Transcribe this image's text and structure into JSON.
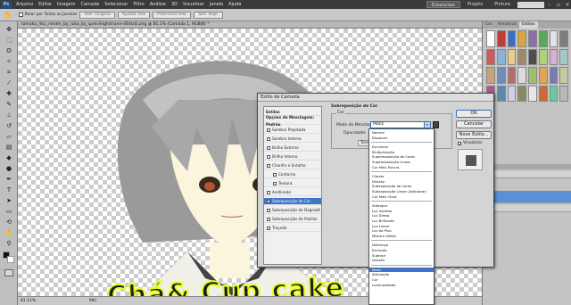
{
  "menubar": {
    "app_badge": "Ps",
    "items": [
      "Arquivo",
      "Editar",
      "Imagem",
      "Camada",
      "Selecionar",
      "Filtro",
      "Análise",
      "3D",
      "Visualizar",
      "Janela",
      "Ajuda"
    ],
    "workspaces": [
      "Essenciais",
      "Projeto",
      "Pintura"
    ],
    "window_controls": [
      "–",
      "▫",
      "×"
    ]
  },
  "options_bar": {
    "checkbox_label": "Rolar por Todas as Janelas",
    "buttons": [
      "Tam. Original",
      "Ajustar Tela",
      "Preencher tela",
      "Tam. Impr."
    ]
  },
  "document": {
    "tab_title": "tamaka_riku_render_by_ruka_by_spmcleightmane-d4hkdz.png @ 81,1% (Camada 1, RGB/8) *"
  },
  "status": {
    "zoom": "81,11%",
    "doc": "Méi"
  },
  "panels": {
    "tabs": [
      "Cor",
      "Amostras",
      "Estilos"
    ],
    "active_tab": "Estilos"
  },
  "dialog": {
    "title": "Estilo de Camada",
    "section_title": "Sobreposição de Cor",
    "group_label": "Cor",
    "blend_mode_label": "Modo de Mesclagem:",
    "blend_mode_value": "Matiz",
    "opacity_label": "Opacidade:",
    "truncated_label": "Tornar",
    "preview_label": "Visualizar",
    "buttons": {
      "ok": "OK",
      "cancel": "Cancelar",
      "new_style": "Novo Estilo..."
    },
    "styles": [
      {
        "label": "Estilos",
        "head": true,
        "checked": false
      },
      {
        "label": "Opções de Mesclagem: Padrão",
        "head": true,
        "checked": false
      },
      {
        "label": "Sombra Projetada",
        "checked": false
      },
      {
        "label": "Sombra Interna",
        "checked": false
      },
      {
        "label": "Brilho Externo",
        "checked": false
      },
      {
        "label": "Brilho Interno",
        "checked": false
      },
      {
        "label": "Chanfro e Entalhe",
        "checked": false
      },
      {
        "label": "Contorno",
        "checked": false,
        "indent": true
      },
      {
        "label": "Textura",
        "checked": false,
        "indent": true
      },
      {
        "label": "Acetinado",
        "checked": false
      },
      {
        "label": "Sobreposição de Cor",
        "checked": true,
        "selected": true
      },
      {
        "label": "Sobreposição de Degradê",
        "checked": false
      },
      {
        "label": "Sobreposição de Padrão",
        "checked": false
      },
      {
        "label": "Traçado",
        "checked": false
      }
    ]
  },
  "blend_dropdown": {
    "groups": [
      [
        "Normal",
        "Dissolver"
      ],
      [
        "Escurecer",
        "Multiplicação",
        "Superexposição de Cores",
        "Superexposição Linear",
        "Cor Mais Escura"
      ],
      [
        "Clarear",
        "Divisão",
        "Subexposição de Cores",
        "Subexposição Linear (Adicionar)",
        "Cor Mais Clara"
      ],
      [
        "Sobrepor",
        "Luz Indireta",
        "Luz Direta",
        "Luz Brilhante",
        "Luz Linear",
        "Luz do Pino",
        "Mistura Sólida"
      ],
      [
        "Diferença",
        "Exclusão",
        "Subtrair",
        "Divisão"
      ],
      [
        "Matiz",
        "Saturação",
        "Cor",
        "Luminosidade"
      ]
    ],
    "selected": "Matiz"
  },
  "watermark": "Chá& Cup cake",
  "colors": {
    "accent": "#3f74c7",
    "watermark_fill": "#1e1e1e",
    "watermark_outline": "#e6ff1e"
  }
}
